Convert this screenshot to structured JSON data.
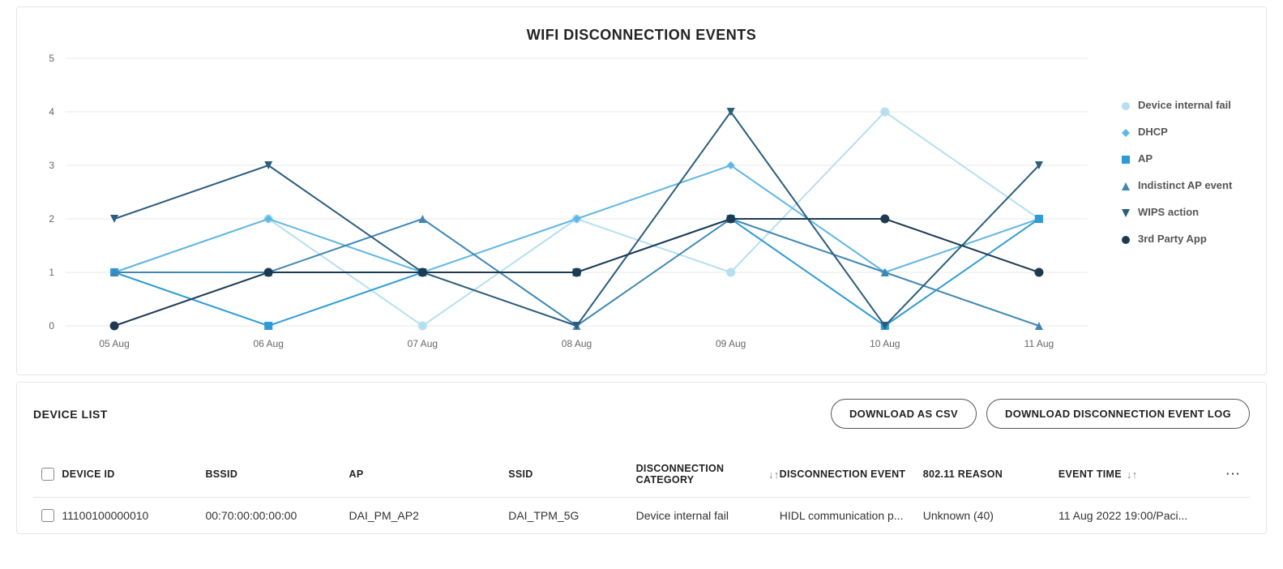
{
  "chart_data": {
    "type": "line",
    "title": "WIFI DISCONNECTION EVENTS",
    "categories": [
      "05 Aug",
      "06 Aug",
      "07 Aug",
      "08 Aug",
      "09 Aug",
      "10 Aug",
      "11 Aug"
    ],
    "ylim": [
      0,
      5
    ],
    "yticks": [
      0,
      1,
      2,
      3,
      4,
      5
    ],
    "xlabel": "",
    "ylabel": "",
    "series": [
      {
        "name": "Device internal fail",
        "color": "#b6dff0",
        "marker": "circle",
        "values": [
          1,
          2,
          0,
          2,
          1,
          4,
          2
        ]
      },
      {
        "name": "DHCP",
        "color": "#5fb7e5",
        "marker": "diamond",
        "values": [
          1,
          2,
          1,
          2,
          3,
          1,
          2
        ]
      },
      {
        "name": "AP",
        "color": "#2e9bd6",
        "marker": "square",
        "values": [
          1,
          0,
          1,
          1,
          2,
          0,
          2
        ]
      },
      {
        "name": "Indistinct AP event",
        "color": "#3f87b2",
        "marker": "triangle-up",
        "values": [
          1,
          1,
          2,
          0,
          2,
          1,
          0
        ]
      },
      {
        "name": "WIPS action",
        "color": "#2c5d7c",
        "marker": "triangle-down",
        "values": [
          2,
          3,
          1,
          0,
          4,
          0,
          3
        ]
      },
      {
        "name": "3rd Party App",
        "color": "#1e3a52",
        "marker": "circle-filled",
        "values": [
          0,
          1,
          1,
          1,
          2,
          2,
          1
        ]
      }
    ]
  },
  "deviceList": {
    "title": "DEVICE LIST",
    "buttons": {
      "csv": "DOWNLOAD AS CSV",
      "log": "DOWNLOAD DISCONNECTION EVENT LOG"
    },
    "columns": {
      "deviceId": "DEVICE ID",
      "bssid": "BSSID",
      "ap": "AP",
      "ssid": "SSID",
      "category": "DISCONNECTION CATEGORY",
      "event": "DISCONNECTION EVENT",
      "reason": "802.11 REASON",
      "time": "EVENT TIME"
    },
    "rows": [
      {
        "deviceId": "11100100000010",
        "bssid": "00:70:00:00:00:00",
        "ap": "DAI_PM_AP2",
        "ssid": "DAI_TPM_5G",
        "category": "Device internal fail",
        "event": "HIDL communication p...",
        "reason": "Unknown (40)",
        "time": "11 Aug 2022 19:00/Paci..."
      }
    ]
  }
}
